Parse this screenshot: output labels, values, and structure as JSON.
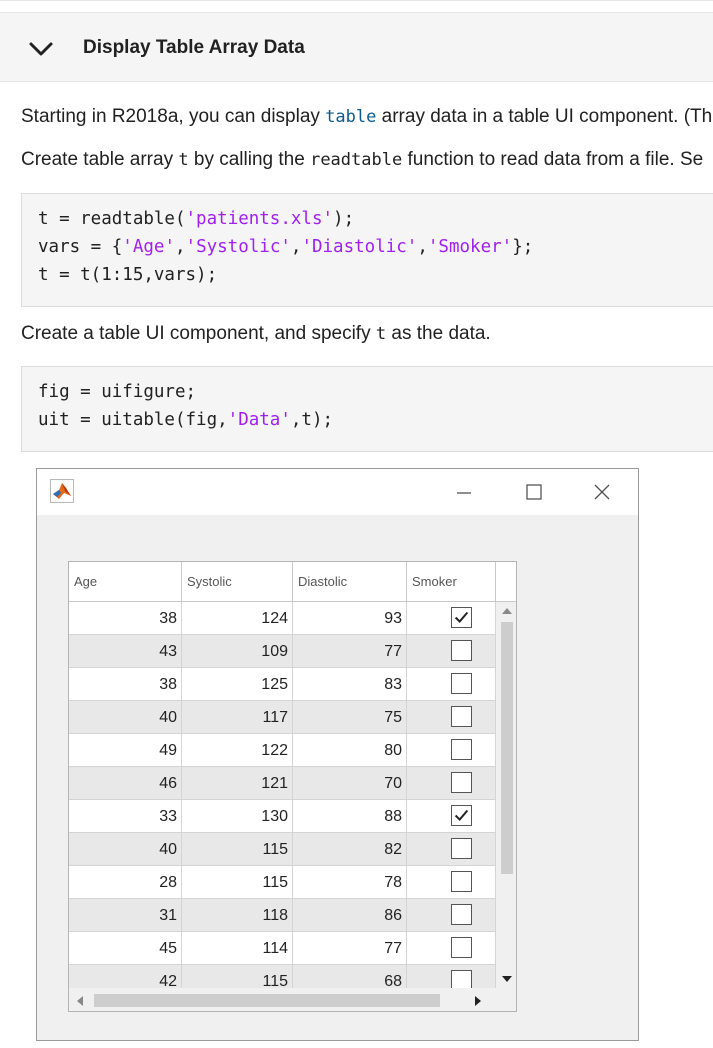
{
  "section": {
    "title": "Display Table Array Data",
    "icon": "chevron-down-icon"
  },
  "intro": {
    "p1_prefix": "Starting in R2018a, you can display ",
    "p1_code": "table",
    "p1_suffix": " array data in a table UI component. (Th",
    "p2_prefix": "Create table array ",
    "p2_code1": "t",
    "p2_mid": " by calling the ",
    "p2_code2": "readtable",
    "p2_suffix": " function to read data from a file. Se"
  },
  "code1": {
    "line1_pre": "t = readtable(",
    "line1_str": "'patients.xls'",
    "line1_post": ");",
    "line2_pre": "vars = {",
    "line2_s1": "'Age'",
    "line2_c1": ",",
    "line2_s2": "'Systolic'",
    "line2_c2": ",",
    "line2_s3": "'Diastolic'",
    "line2_c3": ",",
    "line2_s4": "'Smoker'",
    "line2_post": "};",
    "line3": "t = t(1:15,vars);"
  },
  "para3": {
    "prefix": "Create a table UI component, and specify ",
    "code": "t",
    "suffix": " as the data."
  },
  "code2": {
    "line1": "fig = uifigure;",
    "line2_pre": "uit = uitable(fig,",
    "line2_str": "'Data'",
    "line2_post": ",t);"
  },
  "figure_window": {
    "icons": {
      "logo": "matlab-logo-icon",
      "minimize": "minimize-icon",
      "maximize": "maximize-icon",
      "close": "close-icon"
    },
    "table": {
      "columns": [
        "Age",
        "Systolic",
        "Diastolic",
        "Smoker"
      ],
      "rows": [
        {
          "age": "38",
          "systolic": "124",
          "diastolic": "93",
          "smoker": true
        },
        {
          "age": "43",
          "systolic": "109",
          "diastolic": "77",
          "smoker": false
        },
        {
          "age": "38",
          "systolic": "125",
          "diastolic": "83",
          "smoker": false
        },
        {
          "age": "40",
          "systolic": "117",
          "diastolic": "75",
          "smoker": false
        },
        {
          "age": "49",
          "systolic": "122",
          "diastolic": "80",
          "smoker": false
        },
        {
          "age": "46",
          "systolic": "121",
          "diastolic": "70",
          "smoker": false
        },
        {
          "age": "33",
          "systolic": "130",
          "diastolic": "88",
          "smoker": true
        },
        {
          "age": "40",
          "systolic": "115",
          "diastolic": "82",
          "smoker": false
        },
        {
          "age": "28",
          "systolic": "115",
          "diastolic": "78",
          "smoker": false
        },
        {
          "age": "31",
          "systolic": "118",
          "diastolic": "86",
          "smoker": false
        },
        {
          "age": "45",
          "systolic": "114",
          "diastolic": "77",
          "smoker": false
        },
        {
          "age": "42",
          "systolic": "115",
          "diastolic": "68",
          "smoker": false
        }
      ]
    }
  }
}
